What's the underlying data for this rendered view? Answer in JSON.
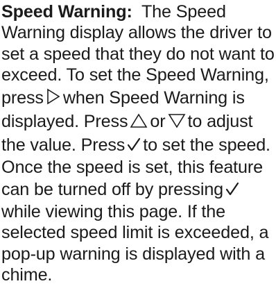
{
  "document": {
    "heading": "Speed Warning:",
    "lines": [
      "The Speed",
      "Warning display allows the driver to",
      "set a speed that they do not want to",
      "exceed. To set the Speed Warning,",
      "press",
      "when Speed Warning is",
      "displayed. Press",
      "or",
      "to adjust",
      "the value. Press",
      "to set the speed.",
      "Once the speed is set, this feature",
      "can be turned off by pressing",
      "while viewing this page. If the",
      "selected speed limit is exceeded, a",
      "pop-up warning is displayed with a",
      "chime."
    ]
  },
  "icons": {
    "right": "right-arrow-icon",
    "up": "up-arrow-icon",
    "down": "down-arrow-icon",
    "check": "checkmark-icon"
  }
}
